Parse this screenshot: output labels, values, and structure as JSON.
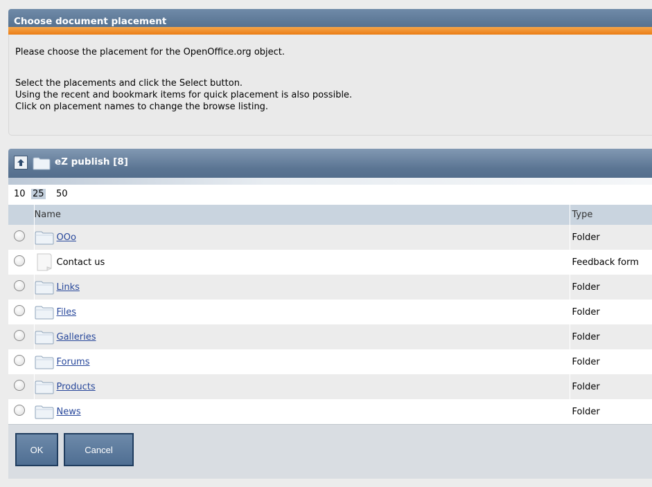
{
  "dialog": {
    "title": "Choose document placement",
    "intro_line1": "Please choose the placement for the OpenOffice.org object.",
    "intro_line2": "Select the placements and click the Select button.",
    "intro_line3": "Using the recent and bookmark items for quick placement is also possible.",
    "intro_line4": "Click on placement names to change the browse listing."
  },
  "browse": {
    "title": "eZ publish [8]",
    "limits": [
      "10",
      "25",
      "50"
    ],
    "selected_limit": "25",
    "columns": {
      "name": "Name",
      "type": "Type"
    },
    "rows": [
      {
        "name": "OOo",
        "type": "Folder",
        "icon": "folder-icon",
        "link": true
      },
      {
        "name": "Contact us",
        "type": "Feedback form",
        "icon": "document-icon",
        "link": false
      },
      {
        "name": "Links",
        "type": "Folder",
        "icon": "folder-icon",
        "link": true
      },
      {
        "name": "Files",
        "type": "Folder",
        "icon": "folder-icon",
        "link": true
      },
      {
        "name": "Galleries",
        "type": "Folder",
        "icon": "folder-icon",
        "link": true
      },
      {
        "name": "Forums",
        "type": "Folder",
        "icon": "folder-icon",
        "link": true
      },
      {
        "name": "Products",
        "type": "Folder",
        "icon": "folder-icon",
        "link": true
      },
      {
        "name": "News",
        "type": "Folder",
        "icon": "folder-icon",
        "link": true
      }
    ]
  },
  "buttons": {
    "ok": "OK",
    "cancel": "Cancel"
  },
  "colors": {
    "header_blue": "#4c6886",
    "header_orange": "#ea7d16",
    "link": "#26469a",
    "button": "#5b7a9e"
  }
}
